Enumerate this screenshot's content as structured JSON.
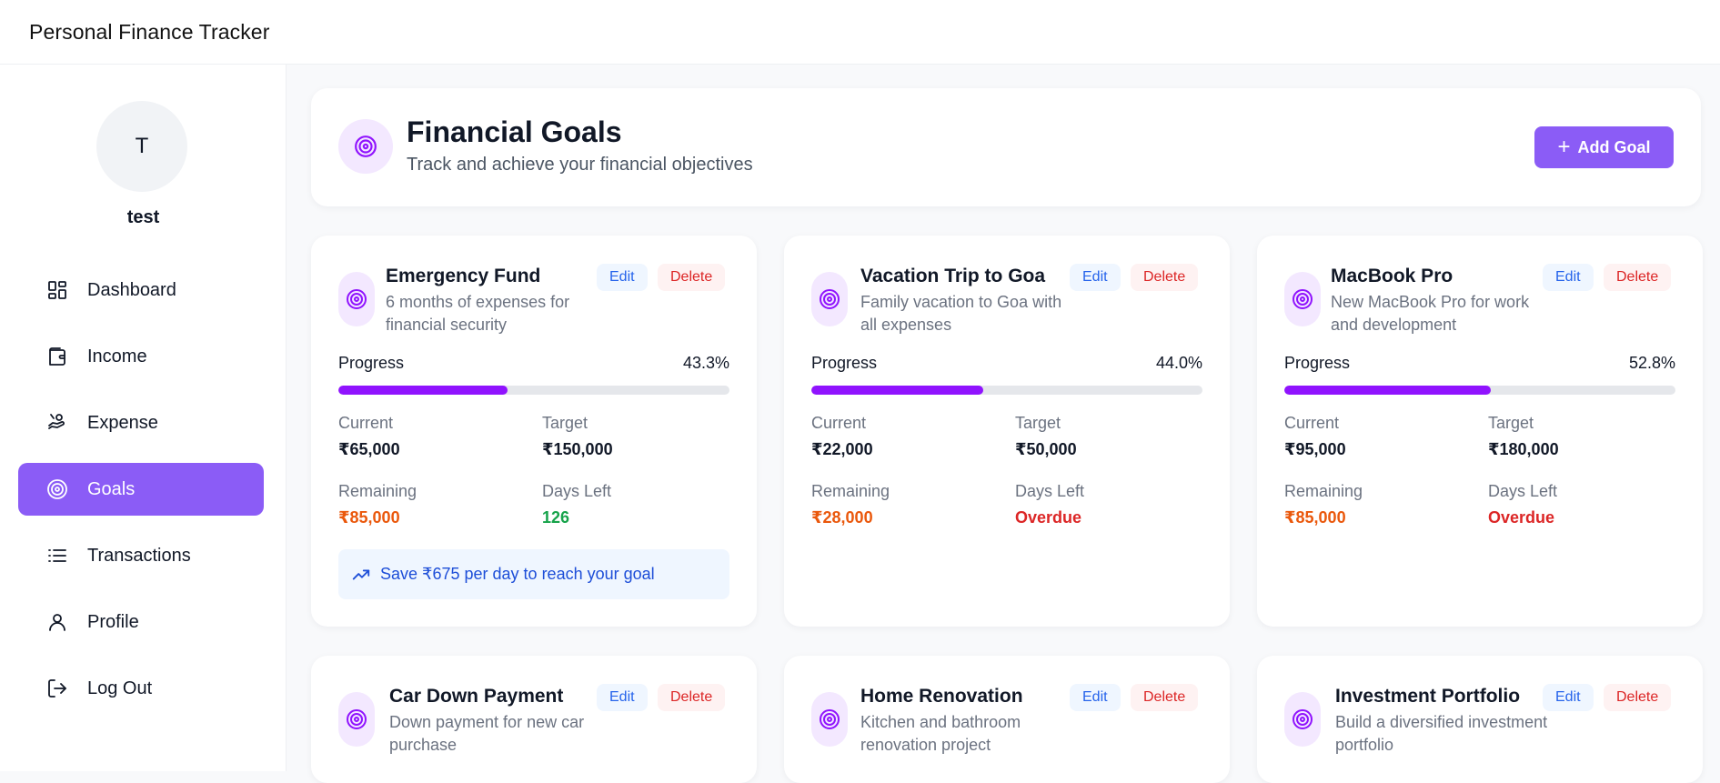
{
  "app": {
    "title": "Personal Finance Tracker"
  },
  "sidebar": {
    "avatar_initial": "T",
    "username": "test",
    "items": [
      {
        "label": "Dashboard",
        "icon": "dashboard-icon"
      },
      {
        "label": "Income",
        "icon": "wallet-icon"
      },
      {
        "label": "Expense",
        "icon": "hand-coins-icon"
      },
      {
        "label": "Goals",
        "icon": "target-icon",
        "active": true
      },
      {
        "label": "Transactions",
        "icon": "list-icon"
      },
      {
        "label": "Profile",
        "icon": "user-icon"
      },
      {
        "label": "Log Out",
        "icon": "logout-icon"
      }
    ]
  },
  "header": {
    "title": "Financial Goals",
    "subtitle": "Track and achieve your financial objectives",
    "add_goal_label": "Add Goal"
  },
  "labels": {
    "progress": "Progress",
    "current": "Current",
    "target": "Target",
    "remaining": "Remaining",
    "days_left": "Days Left",
    "edit": "Edit",
    "delete": "Delete"
  },
  "goals": [
    {
      "name": "Emergency Fund",
      "description": "6 months of expenses for financial security",
      "progress_text": "43.3%",
      "progress": 0.433,
      "current": "₹65,000",
      "target": "₹150,000",
      "remaining": "₹85,000",
      "days_left": "126",
      "days_status": "green",
      "tip": "Save ₹675 per day to reach your goal"
    },
    {
      "name": "Vacation Trip to Goa",
      "description": "Family vacation to Goa with all expenses",
      "progress_text": "44.0%",
      "progress": 0.44,
      "current": "₹22,000",
      "target": "₹50,000",
      "remaining": "₹28,000",
      "days_left": "Overdue",
      "days_status": "red"
    },
    {
      "name": "MacBook Pro",
      "description": "New MacBook Pro for work and development",
      "progress_text": "52.8%",
      "progress": 0.528,
      "current": "₹95,000",
      "target": "₹180,000",
      "remaining": "₹85,000",
      "days_left": "Overdue",
      "days_status": "red"
    },
    {
      "name": "Car Down Payment",
      "description": "Down payment for new car purchase"
    },
    {
      "name": "Home Renovation",
      "description": "Kitchen and bathroom renovation project"
    },
    {
      "name": "Investment Portfolio",
      "description": "Build a diversified investment portfolio"
    }
  ],
  "colors": {
    "accent": "#8b5cf6",
    "progress_fill": "#9013fe",
    "remaining": "#ea580c",
    "days_ok": "#16a34a",
    "overdue": "#dc2626"
  }
}
